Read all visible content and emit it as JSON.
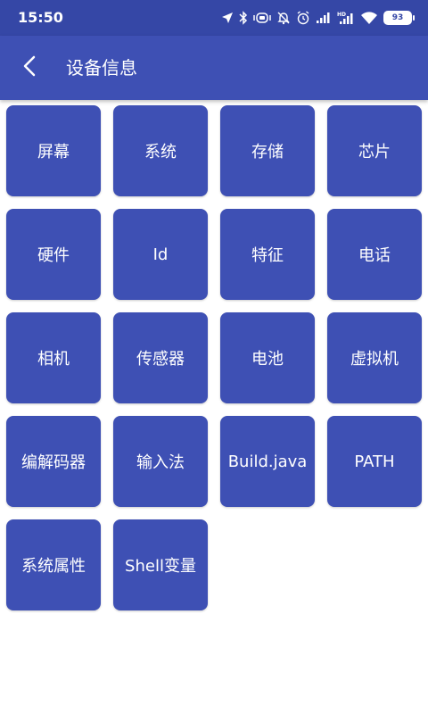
{
  "status_bar": {
    "time": "15:50",
    "battery": "93",
    "icons": [
      "location-arrow-icon",
      "bluetooth-icon",
      "vibrate-icon",
      "mute-bell-icon",
      "alarm-icon",
      "signal-icon",
      "hd-signal-icon",
      "wifi-icon",
      "battery-icon"
    ]
  },
  "app_bar": {
    "title": "设备信息",
    "back_icon": "chevron-left-icon"
  },
  "tiles": [
    {
      "label": "屏幕"
    },
    {
      "label": "系统"
    },
    {
      "label": "存储"
    },
    {
      "label": "芯片"
    },
    {
      "label": "硬件"
    },
    {
      "label": "Id"
    },
    {
      "label": "特征"
    },
    {
      "label": "电话"
    },
    {
      "label": "相机"
    },
    {
      "label": "传感器"
    },
    {
      "label": "电池"
    },
    {
      "label": "虚拟机"
    },
    {
      "label": "编解码器"
    },
    {
      "label": "输入法"
    },
    {
      "label": "Build.java"
    },
    {
      "label": "PATH"
    },
    {
      "label": "系统属性"
    },
    {
      "label": "Shell变量"
    }
  ],
  "colors": {
    "status_bar": "#3547a6",
    "primary": "#3e50b4",
    "text_on_primary": "#ffffff",
    "background": "#ffffff"
  }
}
